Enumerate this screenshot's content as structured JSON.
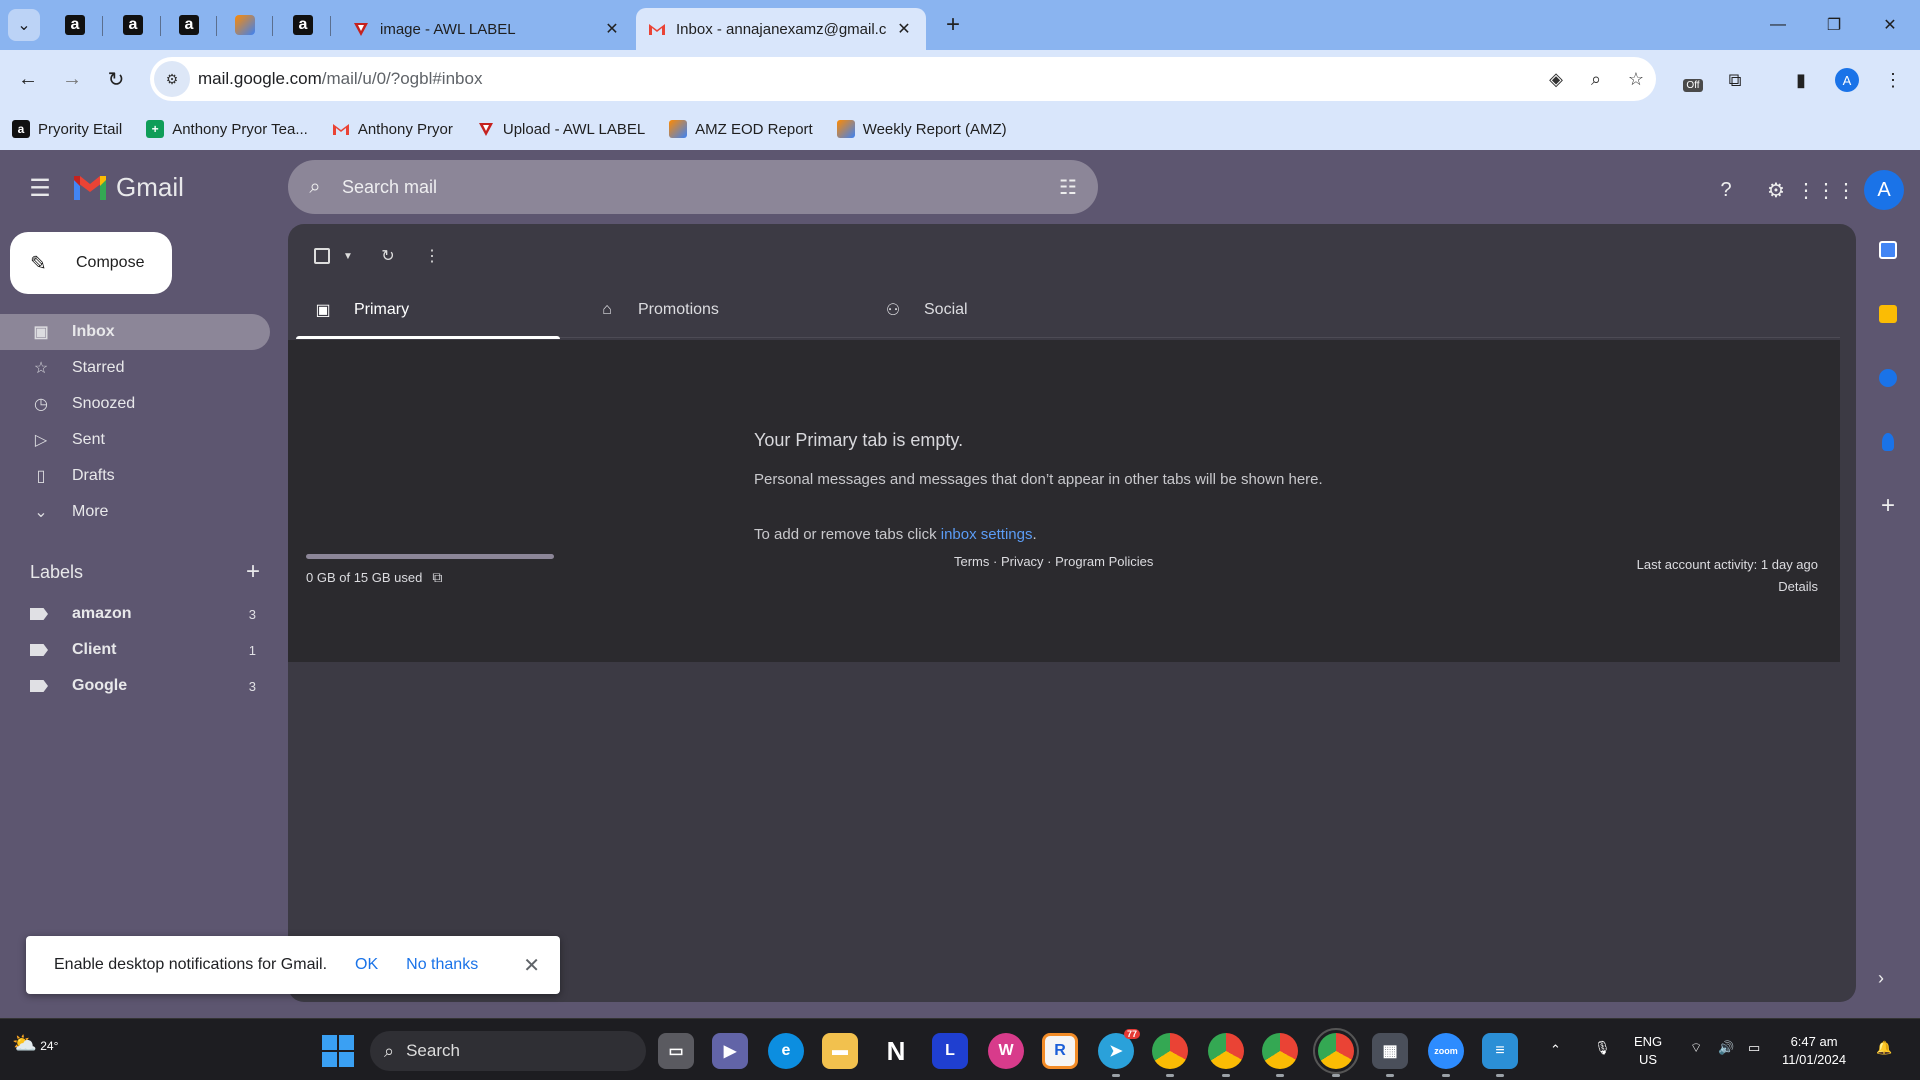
{
  "browser": {
    "tabs": [
      {
        "label": "image - AWL LABEL",
        "active": false
      },
      {
        "label": "Inbox - annajanexamz@gmail.c",
        "active": true
      }
    ],
    "pinned_tabs": [
      "a",
      "a",
      "a",
      "✓",
      "a"
    ],
    "url_host": "mail.google.com",
    "url_path": "/mail/u/0/?ogbl#inbox",
    "profile_initial": "A",
    "extension_badge": "Off",
    "bookmarks": [
      {
        "label": "Pryority Etail",
        "icon": "amazon-icon",
        "color": "#111111"
      },
      {
        "label": "Anthony Pryor Tea...",
        "icon": "sheets-icon",
        "color": "#0f9d58"
      },
      {
        "label": "Anthony Pryor",
        "icon": "gmail-icon",
        "color": "#ea4335"
      },
      {
        "label": "Upload - AWL LABEL",
        "icon": "awl-icon",
        "color": "#c5221f"
      },
      {
        "label": "AMZ EOD Report",
        "icon": "report-icon",
        "color": "#ff8a00"
      },
      {
        "label": "Weekly Report (AMZ)",
        "icon": "report-icon",
        "color": "#ff8a00"
      }
    ]
  },
  "gmail": {
    "app_name": "Gmail",
    "search_placeholder": "Search mail",
    "compose_label": "Compose",
    "nav": [
      {
        "label": "Inbox",
        "icon": "inbox-icon",
        "selected": true
      },
      {
        "label": "Starred",
        "icon": "star-icon",
        "selected": false
      },
      {
        "label": "Snoozed",
        "icon": "clock-icon",
        "selected": false
      },
      {
        "label": "Sent",
        "icon": "send-icon",
        "selected": false
      },
      {
        "label": "Drafts",
        "icon": "draft-icon",
        "selected": false
      },
      {
        "label": "More",
        "icon": "chevron-down-icon",
        "selected": false
      }
    ],
    "labels_title": "Labels",
    "labels": [
      {
        "name": "amazon",
        "count": "3"
      },
      {
        "name": "Client",
        "count": "1"
      },
      {
        "name": "Google",
        "count": "3"
      }
    ],
    "inbox_tabs": [
      {
        "label": "Primary",
        "icon": "inbox-icon",
        "selected": true
      },
      {
        "label": "Promotions",
        "icon": "tag-icon",
        "selected": false
      },
      {
        "label": "Social",
        "icon": "people-icon",
        "selected": false
      }
    ],
    "empty_state": {
      "title": "Your Primary tab is empty.",
      "body": "Personal messages and messages that don’t appear in other tabs will be shown here.",
      "settings_prefix": "To add or remove tabs click ",
      "settings_link": "inbox settings",
      "settings_suffix": "."
    },
    "storage": "0 GB of 15 GB used",
    "storage_fraction": 0.0,
    "policies": "Terms · Privacy · Program Policies",
    "last_activity": "Last account activity: 1 day ago",
    "details_link": "Details",
    "account_initial": "A",
    "notification": {
      "message": "Enable desktop notifications for Gmail.",
      "ok": "OK",
      "no_thanks": "No thanks"
    }
  },
  "taskbar": {
    "weather": "24°",
    "search_label": "Search",
    "language": "ENG",
    "region": "US",
    "time": "6:47 am",
    "date": "11/01/2024",
    "telegram_badge": "77"
  }
}
